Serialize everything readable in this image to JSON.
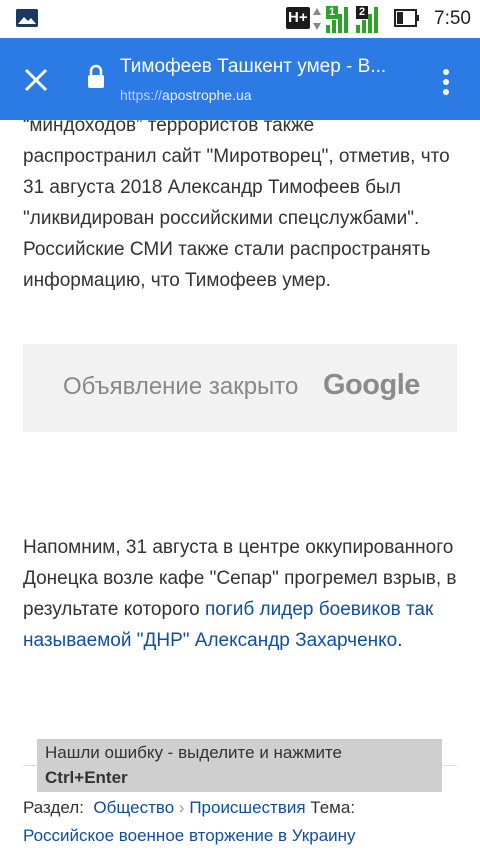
{
  "status_bar": {
    "network_type": "H+",
    "sim1_badge": "1",
    "sim2_badge": "2",
    "time": "7:50",
    "icons": [
      "gallery-icon",
      "data-arrows-icon",
      "signal-icon",
      "signal-icon",
      "battery-icon"
    ]
  },
  "toolbar": {
    "title": "Тимофеев Ташкент умер - В...",
    "url_scheme": "https://",
    "url_host": "apostrophe.ua",
    "icons": [
      "close-icon",
      "lock-icon",
      "more-vert-icon"
    ],
    "accent_color": "#2c7be5"
  },
  "article": {
    "para1_partial": "“миндоходов” террористов также",
    "para1": "распространил сайт \"Миротворец\", отметив, что 31 августа 2018 Александр Тимофеев был \"ликвидирован российскими спецслужбами\". Российские СМИ также стали распространять информацию, что Тимофеев умер.",
    "ad_text": "Объявление закрыто",
    "ad_brand": "Google",
    "para2_text": "Напомним, 31 августа в центре оккупированного Донецка возле кафе \"Сепар\" прогремел взрыв, в результате которого ",
    "para2_link": "погиб лидер боевиков так называемой \"ДНР\" Александр Захарченко",
    "para2_end": "."
  },
  "report_error": {
    "line1": "Нашли ошибку - выделите и нажмите",
    "line2": "Ctrl+Enter"
  },
  "meta": {
    "section_label": "Раздел:",
    "section1": "Общество",
    "separator": "›",
    "section2": "Происшествия",
    "topic_label": "Тема:",
    "topic": "Российское военное вторжение в Украину"
  }
}
